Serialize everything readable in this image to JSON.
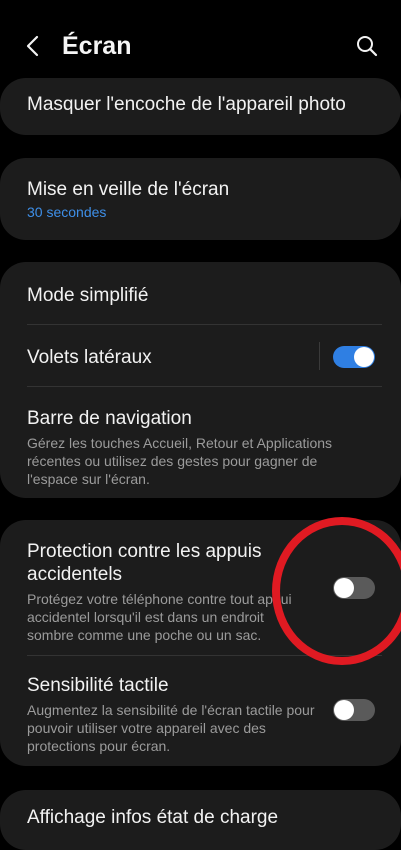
{
  "header": {
    "title": "Écran",
    "back_icon": "chevron-left-icon",
    "search_icon": "search-icon"
  },
  "settings": {
    "notch": {
      "title": "Masquer l'encoche de l'appareil photo"
    },
    "screen_timeout": {
      "title": "Mise en veille de l'écran",
      "value": "30 secondes"
    },
    "easy_mode": {
      "title": "Mode simplifié"
    },
    "edge_panels": {
      "title": "Volets latéraux",
      "enabled": true
    },
    "navigation_bar": {
      "title": "Barre de navigation",
      "description": "Gérez les touches Accueil, Retour et Applications récentes ou utilisez des gestes pour gagner de l'espace sur l'écran."
    },
    "accidental_touch": {
      "title": "Protection contre les appuis accidentels",
      "description": "Protégez votre téléphone contre tout appui accidentel lorsqu'il est dans un endroit sombre comme une poche ou un sac.",
      "enabled": false
    },
    "touch_sensitivity": {
      "title": "Sensibilité tactile",
      "description": "Augmentez la sensibilité de l'écran tactile pour pouvoir utiliser votre appareil avec des protections pour écran.",
      "enabled": false
    },
    "charging_info": {
      "title": "Affichage infos état de charge"
    }
  },
  "colors": {
    "background": "#000000",
    "card": "#1c1c1c",
    "accent": "#2f7fe3",
    "value_text": "#3e8fe8",
    "annotation": "#e01a22"
  }
}
